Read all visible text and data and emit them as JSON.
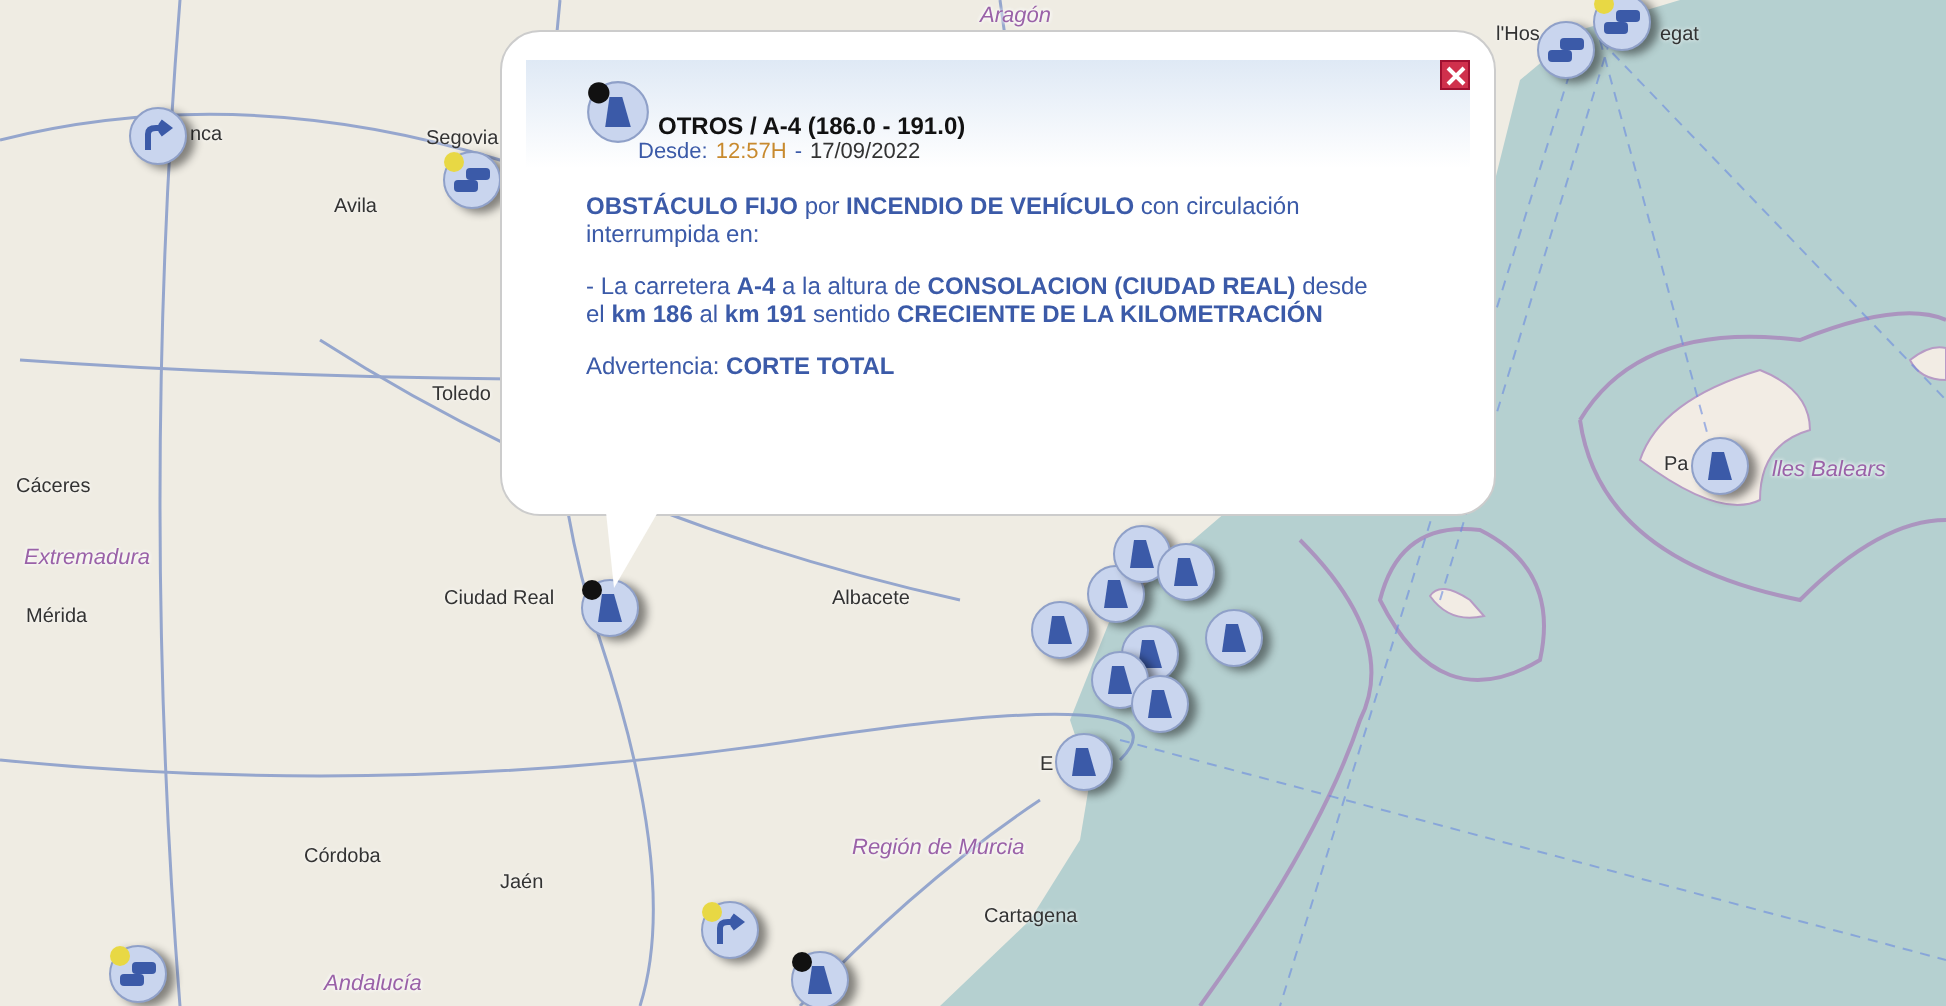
{
  "map": {
    "labels": [
      {
        "text": "Aragón",
        "kind": "region"
      },
      {
        "text": "nca",
        "kind": "city"
      },
      {
        "text": "Segovia",
        "kind": "city"
      },
      {
        "text": "Avila",
        "kind": "city"
      },
      {
        "text": "Toledo",
        "kind": "city"
      },
      {
        "text": "Cáceres",
        "kind": "city"
      },
      {
        "text": "Extremadura",
        "kind": "region"
      },
      {
        "text": "Mérida",
        "kind": "city"
      },
      {
        "text": "Ciudad Real",
        "kind": "city"
      },
      {
        "text": "Albacete",
        "kind": "city"
      },
      {
        "text": "Córdoba",
        "kind": "city"
      },
      {
        "text": "Jaén",
        "kind": "city"
      },
      {
        "text": "Andalucía",
        "kind": "region"
      },
      {
        "text": "Región de Murcia",
        "kind": "region"
      },
      {
        "text": "Cartagena",
        "kind": "city"
      },
      {
        "text": "E",
        "kind": "city"
      },
      {
        "text": "l'Hos",
        "kind": "city"
      },
      {
        "text": "egat",
        "kind": "city"
      },
      {
        "text": "Pa",
        "kind": "city"
      },
      {
        "text": "lles Balears",
        "kind": "region"
      }
    ]
  },
  "popup": {
    "title": "OTROS / A-4 (186.0 - 191.0)",
    "since_label": "Desde:",
    "time": "12:57H",
    "separator": "-",
    "date": "17/09/2022",
    "paragraphs": [
      "**OBSTÁCULO FIJO** por **INCENDIO DE VEHÍCULO** con circulación interrumpida en:",
      "- La carretera **A-4** a la altura de **CONSOLACION (CIUDAD REAL)** desde el **km 186** al **km 191** sentido **CRECIENTE DE LA KILOMETRACIÓN**",
      "Advertencia: **CORTE TOTAL**"
    ]
  }
}
